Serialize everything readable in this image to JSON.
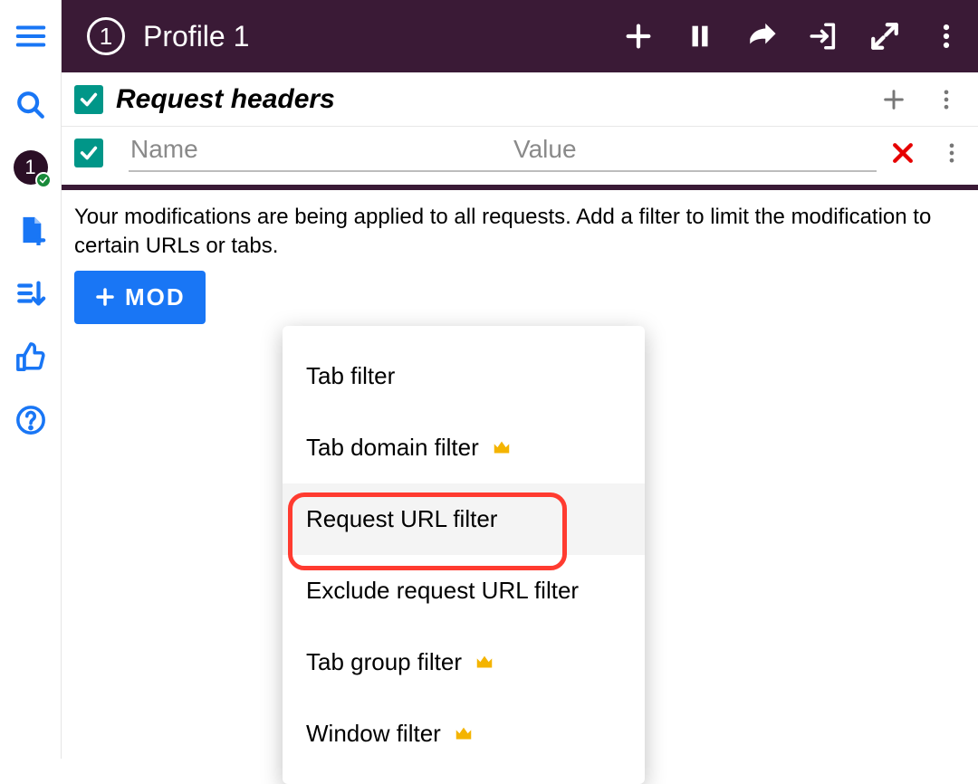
{
  "header": {
    "badge_number": "1",
    "title": "Profile 1"
  },
  "sidebar": {
    "profile_badge_number": "1"
  },
  "section": {
    "title": "Request headers",
    "name_placeholder": "Name",
    "value_placeholder": "Value"
  },
  "hint": "Your modifications are being applied to all requests. Add a filter to limit the modification to certain URLs or tabs.",
  "mod_button_label": "MOD",
  "menu": {
    "items": [
      {
        "label": "Tab filter",
        "premium": false,
        "highlighted": false
      },
      {
        "label": "Tab domain filter",
        "premium": true,
        "highlighted": false
      },
      {
        "label": "Request URL filter",
        "premium": false,
        "highlighted": true
      },
      {
        "label": "Exclude request URL filter",
        "premium": false,
        "highlighted": false
      },
      {
        "label": "Tab group filter",
        "premium": true,
        "highlighted": false
      },
      {
        "label": "Window filter",
        "premium": true,
        "highlighted": false
      }
    ]
  }
}
